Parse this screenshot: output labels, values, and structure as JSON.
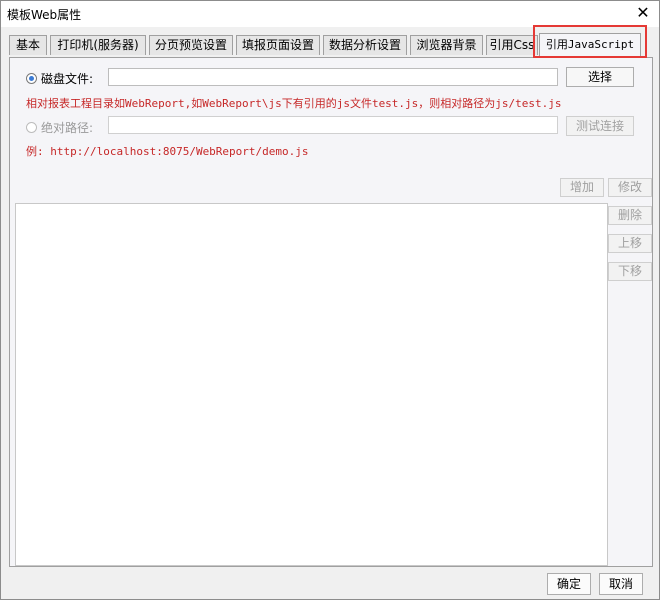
{
  "window": {
    "title": "模板Web属性",
    "close_symbol": "✕"
  },
  "tabs": [
    {
      "label": "基本"
    },
    {
      "label": "打印机(服务器)"
    },
    {
      "label": "分页预览设置"
    },
    {
      "label": "填报页面设置"
    },
    {
      "label": "数据分析设置"
    },
    {
      "label": "浏览器背景"
    },
    {
      "label": "引用Css"
    },
    {
      "label": "引用JavaScript",
      "active": true
    }
  ],
  "panel": {
    "disk_file": {
      "label": "磁盘文件:",
      "value": "",
      "choose_button": "选择",
      "selected": true
    },
    "disk_note": "相对报表工程目录如WebReport,如WebReport\\js下有引用的js文件test.js，则相对路径为js/test.js",
    "absolute_path": {
      "label": "绝对路径:",
      "value": "",
      "test_button": "测试连接",
      "selected": false
    },
    "example_note": "例: http://localhost:8075/WebReport/demo.js",
    "buttons": {
      "add": "增加",
      "modify": "修改",
      "delete": "删除",
      "move_up": "上移",
      "move_down": "下移"
    },
    "list_items": []
  },
  "footer": {
    "ok": "确定",
    "cancel": "取消"
  },
  "colors": {
    "note_red": "#c62828",
    "highlight_red": "#e53935",
    "radio_blue": "#3b7bd5"
  }
}
